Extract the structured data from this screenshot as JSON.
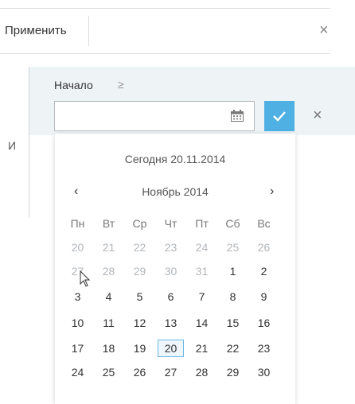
{
  "toolbar": {
    "apply_label": "Применить",
    "close_icon": "×"
  },
  "condition": {
    "logic_label": "И",
    "field_label": "Начало",
    "operator": "≥",
    "input_value": "",
    "ok_icon": "check",
    "cancel_icon": "×"
  },
  "datepicker": {
    "today_label": "Сегодня 20.11.2014",
    "month_label": "Ноябрь 2014",
    "prev": "‹",
    "next": "›",
    "weekdays": [
      "Пн",
      "Вт",
      "Ср",
      "Чт",
      "Пт",
      "Сб",
      "Вс"
    ],
    "weeks": [
      [
        "20",
        "21",
        "22",
        "23",
        "24",
        "25",
        "26"
      ],
      [
        "27",
        "28",
        "29",
        "30",
        "31",
        "1",
        "2"
      ],
      [
        "3",
        "4",
        "5",
        "6",
        "7",
        "8",
        "9"
      ],
      [
        "10",
        "11",
        "12",
        "13",
        "14",
        "15",
        "16"
      ],
      [
        "17",
        "18",
        "19",
        "20",
        "21",
        "22",
        "23"
      ],
      [
        "24",
        "25",
        "26",
        "27",
        "28",
        "29",
        "30"
      ]
    ],
    "selected": "20"
  }
}
